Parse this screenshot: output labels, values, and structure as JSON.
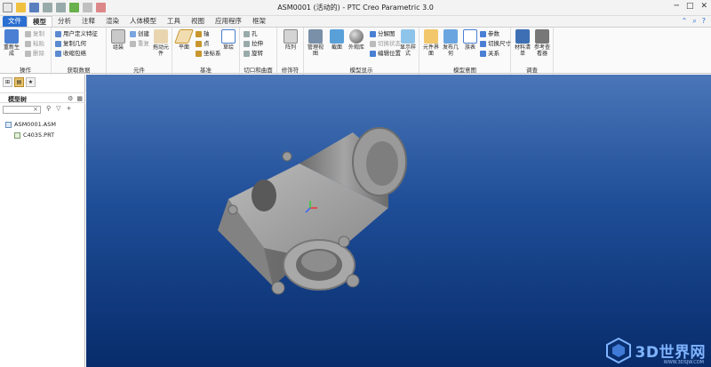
{
  "titlebar": {
    "title": "ASM0001 (活动的) - PTC Creo Parametric 3.0"
  },
  "tabs": [
    "文件",
    "模型",
    "分析",
    "注释",
    "渲染",
    "人体模型",
    "工具",
    "视图",
    "应用程序",
    "框架"
  ],
  "ribbon": {
    "op": {
      "label": "操作",
      "regen": "重新生成",
      "copy": "复制",
      "paste": "粘贴",
      "delete": "删除"
    },
    "data": {
      "label": "获取数据",
      "udf": "用户定义特征",
      "copygeom": "复制几何",
      "shrink": "收缩包络"
    },
    "comp": {
      "label": "元件",
      "assemble": "组装",
      "create": "创建",
      "repeat": "重复",
      "drag": "拖动元件"
    },
    "datum": {
      "label": "基准",
      "plane": "平面",
      "axis": "轴",
      "point": "点",
      "csys": "坐标系",
      "sketch": "草绘"
    },
    "cut": {
      "label": "切口和曲面",
      "hole": "孔",
      "extrude": "拉伸",
      "revolve": "旋转"
    },
    "mod": {
      "label": "修饰符",
      "pattern": "阵列"
    },
    "disp": {
      "label": "模型显示",
      "manage": "管理视图",
      "section": "截面",
      "appearance": "外观库",
      "explode": "分解图",
      "togglestate": "切换状态",
      "editpos": "编辑位置",
      "displaystyle": "显示样式"
    },
    "intent": {
      "label": "模型意图",
      "skeleton": "元件界面",
      "publish": "发布几何",
      "table": "族表",
      "params": "参数",
      "switchdim": "切换尺寸",
      "relations": "关系"
    },
    "invest": {
      "label": "调查",
      "bom": "材料清单",
      "refviewer": "参考查看器"
    }
  },
  "modeltree": {
    "header": "模型树",
    "items": [
      "ASM0001.ASM",
      "C4035.PRT"
    ]
  },
  "watermark": {
    "logo_text": "3D世界网",
    "sub": "WWW.3DSJW.COM"
  },
  "colors": {
    "file_tab": "#2a6fd1",
    "viewport_top": "#4a76b8",
    "viewport_bottom": "#082c6b"
  }
}
